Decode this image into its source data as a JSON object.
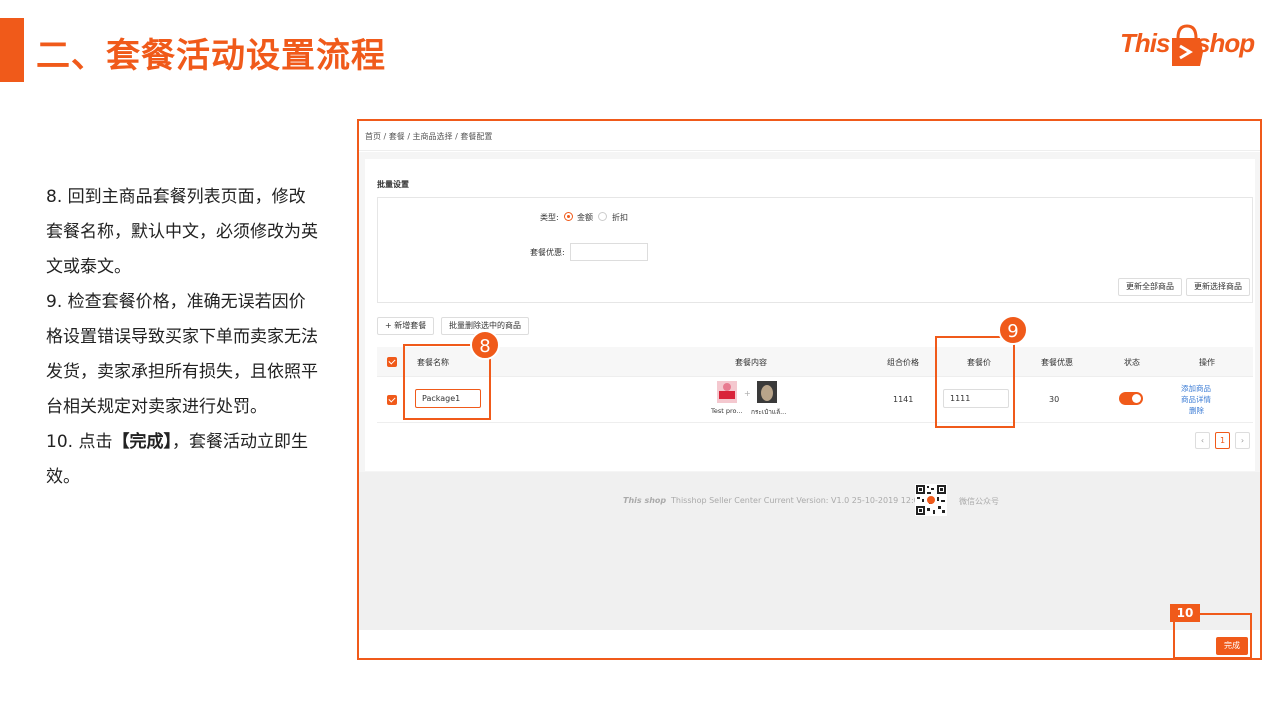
{
  "slide": {
    "title": "二、套餐活动设置流程",
    "logo_left": "This",
    "logo_right": "shop"
  },
  "instructions": {
    "step8": "8. 回到主商品套餐列表页面，修改套餐名称，默认中文，必须修改为英文或泰文。",
    "step9": "9. 检查套餐价格，准确无误若因价格设置错误导致买家下单而卖家无法发货，卖家承担所有损失，且依照平台相关规定对卖家进行处罚。",
    "step10_prefix": "10. 点击",
    "step10_bold": "【完成】",
    "step10_suffix": "，套餐活动立即生效。"
  },
  "screenshot": {
    "breadcrumb": "首页 / 套餐 / 主商品选择 / 套餐配置",
    "batch": {
      "title": "批量设置",
      "type_label": "类型:",
      "option_amount": "金额",
      "option_discount": "折扣",
      "selected": "金额",
      "discount_label": "套餐优惠:",
      "discount_value": "",
      "update_all": "更新全部商品",
      "update_selected": "更新选择商品"
    },
    "toolbar": {
      "add_package": "+ 新增套餐",
      "batch_delete": "批量删除选中的商品"
    },
    "table": {
      "headers": [
        "套餐名称",
        "套餐内容",
        "组合价格",
        "套餐价",
        "套餐优惠",
        "状态",
        "操作"
      ],
      "rows": [
        {
          "name": "Package1",
          "items": [
            "Test pro...",
            "กระเป๋าแล้..."
          ],
          "combo_price": "1141",
          "package_price": "1111",
          "discount": "30",
          "status_on": true,
          "actions": [
            "添加商品",
            "商品详情",
            "删除"
          ]
        }
      ]
    },
    "pagination": {
      "prev": "‹",
      "current": "1",
      "next": "›"
    },
    "footer": {
      "text": "Thisshop Seller Center    Current Version: V1.0    25-10-2019 12:00",
      "logo": "This shop",
      "wechat": "微信公众号"
    },
    "done_button": "完成"
  },
  "callouts": {
    "badge8": "8",
    "badge9": "9",
    "tag10": "10"
  },
  "colors": {
    "accent": "#f05a1a",
    "link": "#3a7bd5"
  }
}
